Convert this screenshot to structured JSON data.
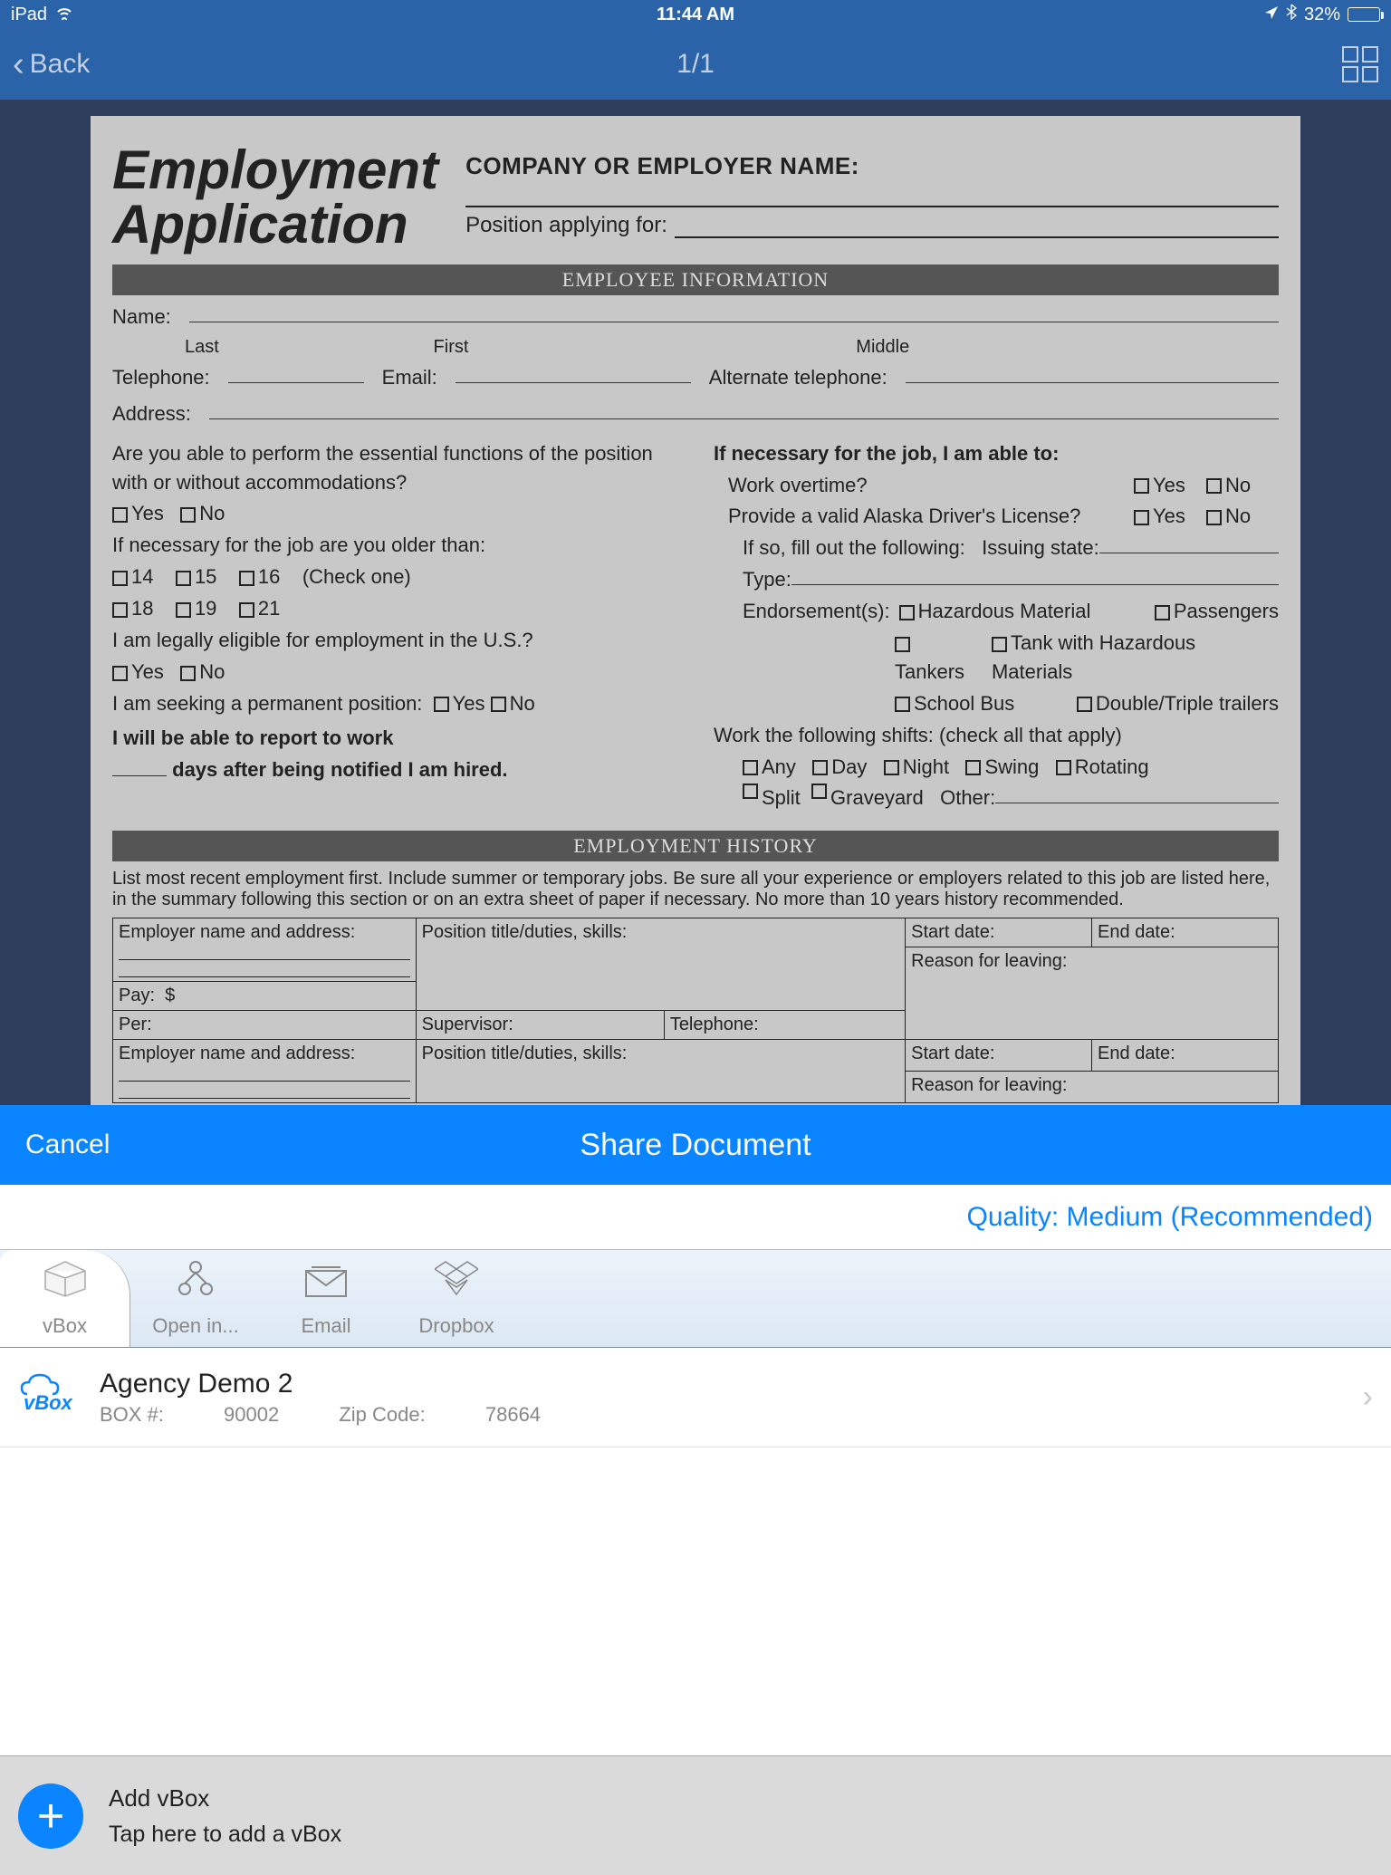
{
  "status": {
    "device": "iPad",
    "time": "11:44 AM",
    "battery_pct": "32%"
  },
  "nav": {
    "back": "Back",
    "counter": "1/1"
  },
  "document": {
    "title_l1": "Employment",
    "title_l2": "Application",
    "company_label": "COMPANY OR EMPLOYER NAME:",
    "position_label": "Position applying for:",
    "section_employee": "EMPLOYEE INFORMATION",
    "name_label": "Name:",
    "name_last": "Last",
    "name_first": "First",
    "name_middle": "Middle",
    "tel_label": "Telephone:",
    "email_label": "Email:",
    "alt_tel_label": "Alternate telephone:",
    "address_label": "Address:",
    "q_essential": "Are you able to perform the essential functions of the position with or without accommodations?",
    "yes": "Yes",
    "no": "No",
    "q_age": "If necessary for the job are you older than:",
    "ages": [
      "14",
      "15",
      "16",
      "18",
      "19",
      "21"
    ],
    "check_one": "(Check one)",
    "q_legal": "I am legally eligible for employment in the U.S.?",
    "q_perm": "I am seeking a permanent position:",
    "q_report_l1": "I will be able to report to work",
    "q_report_l2": "days after being notified I am hired.",
    "q_necessary_bold": "If necessary for the job, I am able to:",
    "q_overtime": "Work overtime?",
    "q_license": "Provide a valid Alaska Driver's License?",
    "q_fillout": "If so, fill out the following:",
    "issuing_state": "Issuing state:",
    "type_label": "Type:",
    "endorse_label": "Endorsement(s):",
    "endorsements": [
      "Hazardous Material",
      "Passengers",
      "Tankers",
      "Tank with Hazardous Materials",
      "School Bus",
      "Double/Triple trailers"
    ],
    "q_shifts": "Work the following shifts: (check all that apply)",
    "shifts": [
      "Any",
      "Day",
      "Night",
      "Swing",
      "Rotating",
      "Split",
      "Graveyard"
    ],
    "other_label": "Other:",
    "section_history": "EMPLOYMENT HISTORY",
    "history_instruct": "List most recent employment first. Include summer or temporary jobs. Be sure all your experience or employers related to this job are listed here, in the summary following this section or on an extra sheet of paper if necessary. No more than 10 years history recommended.",
    "hist_employer": "Employer name and address:",
    "hist_position": "Position title/duties, skills:",
    "hist_start": "Start date:",
    "hist_end": "End date:",
    "hist_reason": "Reason for leaving:",
    "hist_pay": "Pay:",
    "hist_dollar": "$",
    "hist_per": "Per:",
    "hist_super": "Supervisor:",
    "hist_tel": "Telephone:"
  },
  "share": {
    "cancel": "Cancel",
    "title": "Share Document",
    "quality": "Quality: Medium (Recommended)",
    "tabs": [
      {
        "label": "vBox",
        "icon": "box"
      },
      {
        "label": "Open in...",
        "icon": "share"
      },
      {
        "label": "Email",
        "icon": "mail"
      },
      {
        "label": "Dropbox",
        "icon": "dropbox"
      }
    ]
  },
  "vbox_item": {
    "logo": "vBox",
    "name": "Agency Demo 2",
    "box_num_label": "BOX #: ",
    "box_num": "90002",
    "zip_label": "Zip Code: ",
    "zip": "78664"
  },
  "footer": {
    "title": "Add vBox",
    "subtitle": "Tap here to add a vBox"
  }
}
